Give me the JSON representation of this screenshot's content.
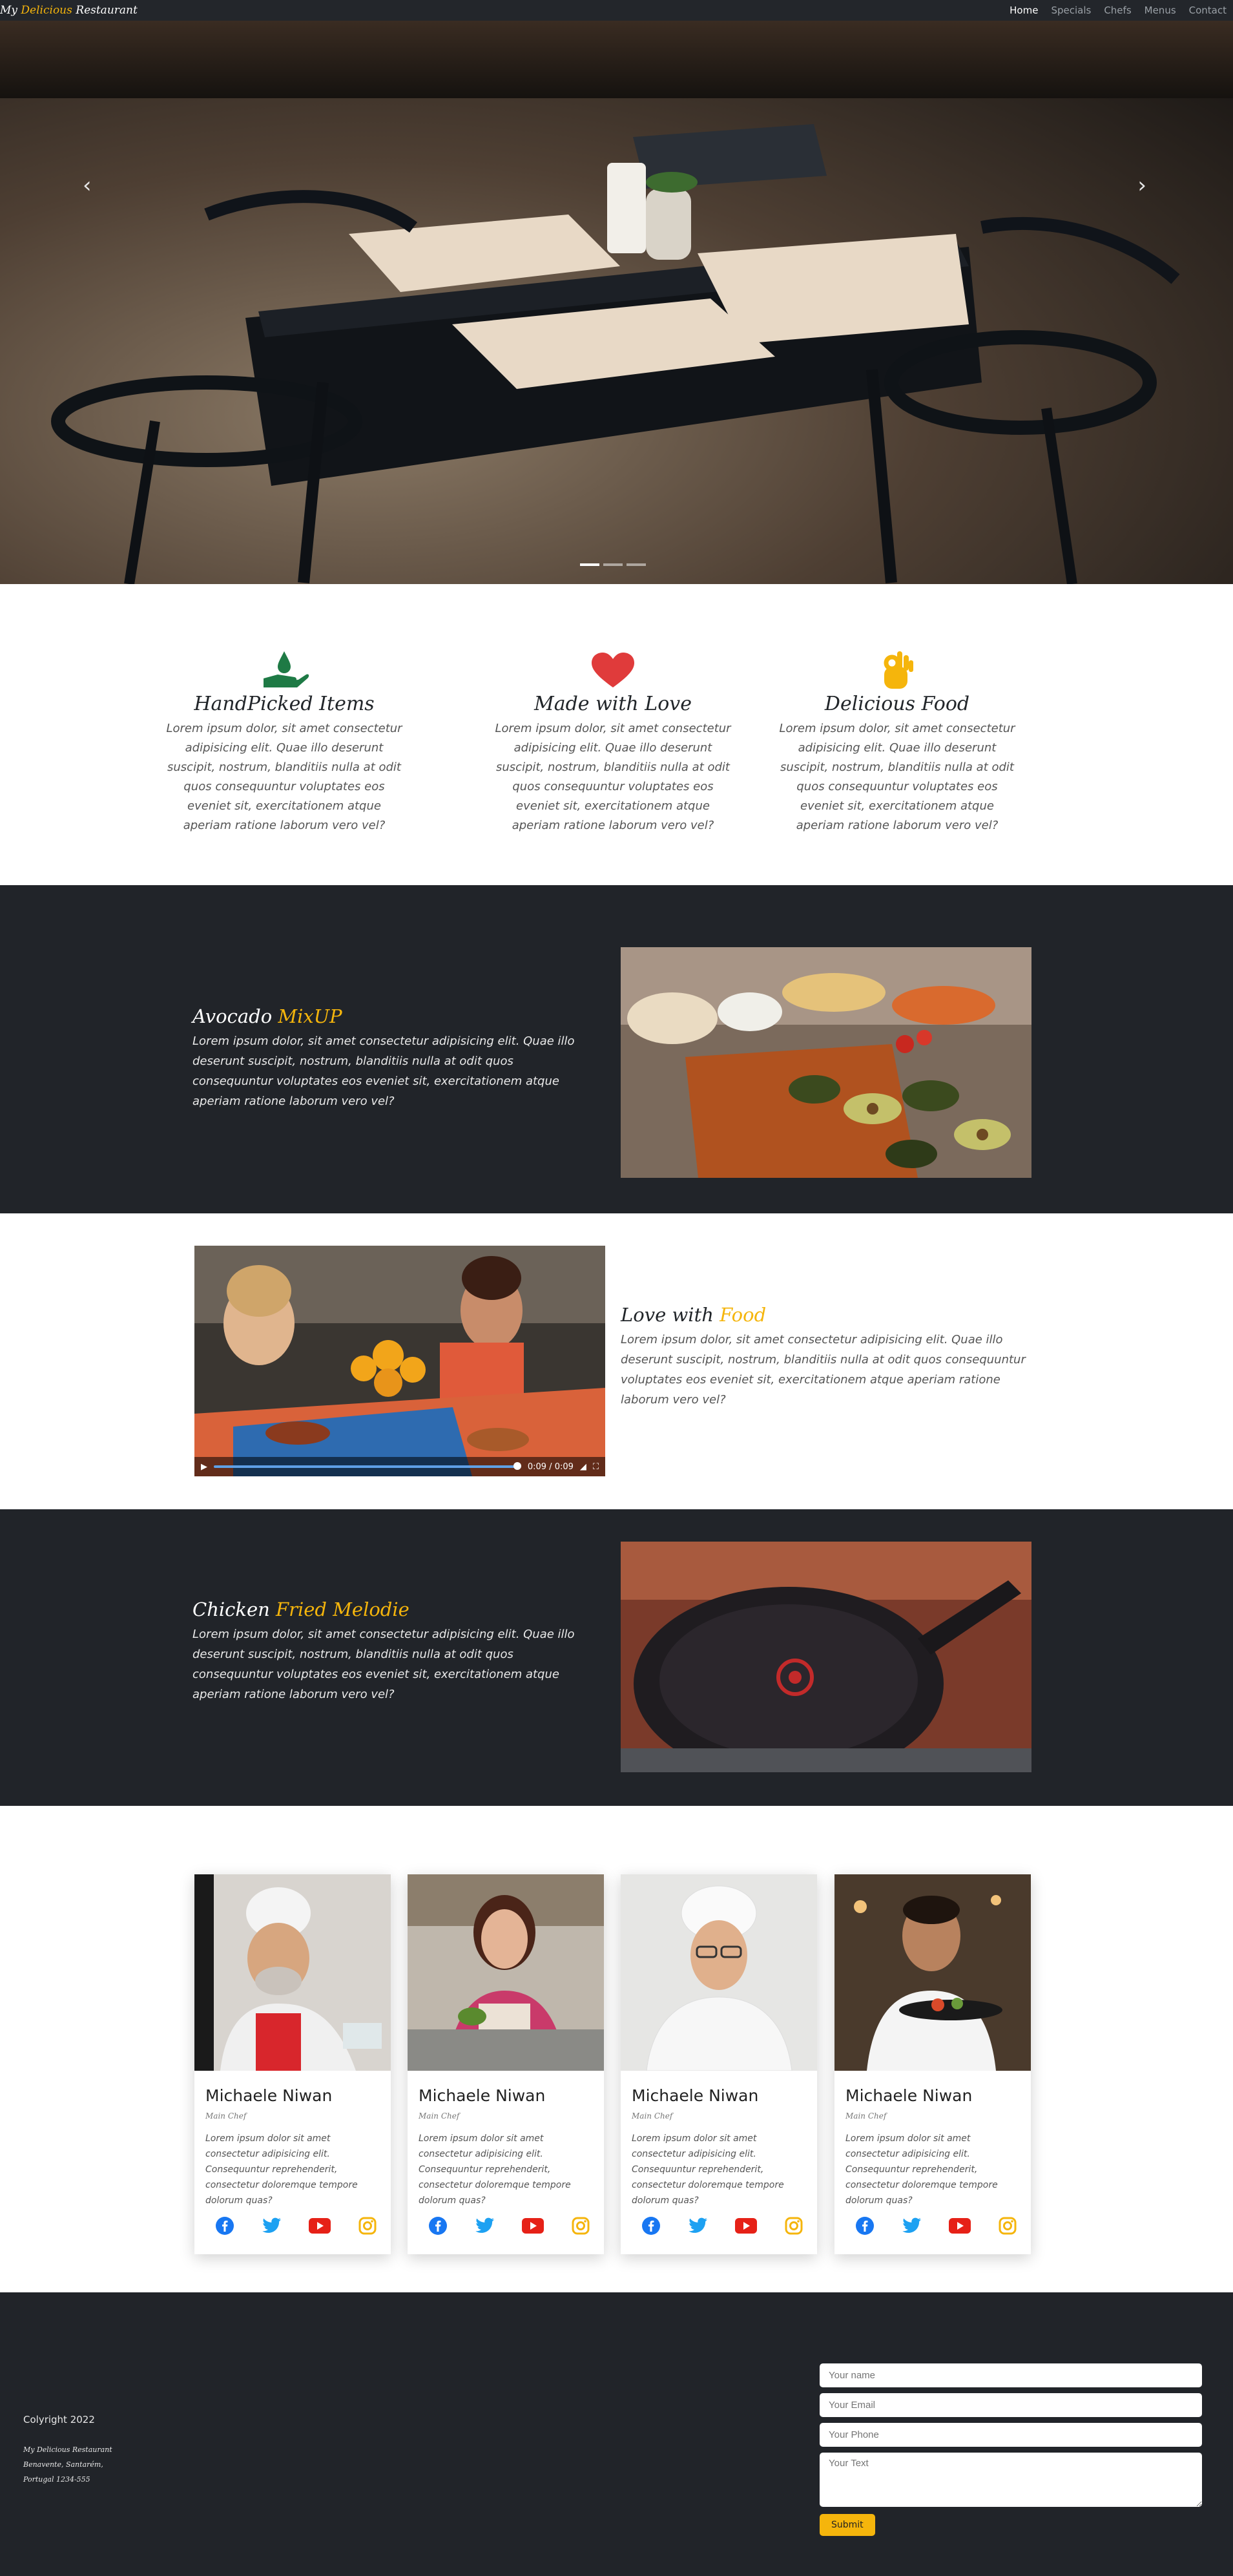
{
  "nav": {
    "brand_prefix": "My",
    "brand_highlight": "Delicious",
    "brand_suffix": "Restaurant",
    "links": [
      "Home",
      "Specials",
      "Chefs",
      "Menus",
      "Contact"
    ]
  },
  "hero": {
    "prev_icon": "chevron-left-icon",
    "next_icon": "chevron-right-icon"
  },
  "features": [
    {
      "title": "HandPicked Items",
      "icon": "hand-drop-icon",
      "text": "Lorem ipsum dolor, sit amet consectetur adipisicing elit. Quae illo deserunt suscipit, nostrum, blanditiis nulla at odit quos consequuntur voluptates eos eveniet sit, exercitationem atque aperiam ratione laborum vero vel?"
    },
    {
      "title": "Made with Love",
      "icon": "heart-icon",
      "text": "Lorem ipsum dolor, sit amet consectetur adipisicing elit. Quae illo deserunt suscipit, nostrum, blanditiis nulla at odit quos consequuntur voluptates eos eveniet sit, exercitationem atque aperiam ratione laborum vero vel?"
    },
    {
      "title": "Delicious Food",
      "icon": "ok-hand-icon",
      "text": "Lorem ipsum dolor, sit amet consectetur adipisicing elit. Quae illo deserunt suscipit, nostrum, blanditiis nulla at odit quos consequuntur voluptates eos eveniet sit, exercitationem atque aperiam ratione laborum vero vel?"
    }
  ],
  "sections": [
    {
      "title_a": "Avocado",
      "title_b": "MixUP",
      "text": "Lorem ipsum dolor, sit amet consectetur adipisicing elit. Quae illo deserunt suscipit, nostrum, blanditiis nulla at odit quos consequuntur voluptates eos eveniet sit, exercitationem atque aperiam ratione laborum vero vel?"
    },
    {
      "title_a": "Love with",
      "title_b": "Food",
      "text": "Lorem ipsum dolor, sit amet consectetur adipisicing elit. Quae illo deserunt suscipit, nostrum, blanditiis nulla at odit quos consequuntur voluptates eos eveniet sit, exercitationem atque aperiam ratione laborum vero vel?"
    },
    {
      "title_a": "Chicken",
      "title_b": "Fried Melodie",
      "text": "Lorem ipsum dolor, sit amet consectetur adipisicing elit. Quae illo deserunt suscipit, nostrum, blanditiis nulla at odit quos consequuntur voluptates eos eveniet sit, exercitationem atque aperiam ratione laborum vero vel?"
    }
  ],
  "video": {
    "time_current": "0:09",
    "time_total": "0:09",
    "progress": 1.0
  },
  "chefs": [
    {
      "name": "Michaele Niwan",
      "role": "Main Chef",
      "text": "Lorem ipsum dolor sit amet consectetur adipisicing elit. Consequuntur reprehenderit, consectetur doloremque tempore dolorum quas?"
    },
    {
      "name": "Michaele Niwan",
      "role": "Main Chef",
      "text": "Lorem ipsum dolor sit amet consectetur adipisicing elit. Consequuntur reprehenderit, consectetur doloremque tempore dolorum quas?"
    },
    {
      "name": "Michaele Niwan",
      "role": "Main Chef",
      "text": "Lorem ipsum dolor sit amet consectetur adipisicing elit. Consequuntur reprehenderit, consectetur doloremque tempore dolorum quas?"
    },
    {
      "name": "Michaele Niwan",
      "role": "Main Chef",
      "text": "Lorem ipsum dolor sit amet consectetur adipisicing elit. Consequuntur reprehenderit, consectetur doloremque tempore dolorum quas?"
    }
  ],
  "social_icons": [
    "facebook-icon",
    "twitter-icon",
    "youtube-icon",
    "instagram-icon"
  ],
  "colors": {
    "accent": "#f5b50c",
    "dark_bg": "#212429",
    "facebook": "#1877f2",
    "twitter": "#1da1f2",
    "youtube": "#e62117",
    "instagram": "#f5b50c"
  },
  "footer": {
    "copyright": "Colyright 2022",
    "address_line1": "My Delicious Restaurant",
    "address_line2": "Benavente, Santarém,",
    "address_line3": "Portugal 1234-555",
    "form": {
      "name_placeholder": "Your name",
      "email_placeholder": "Your Email",
      "phone_placeholder": "Your Phone",
      "text_placeholder": "Your Text",
      "submit_label": "Submit"
    }
  }
}
